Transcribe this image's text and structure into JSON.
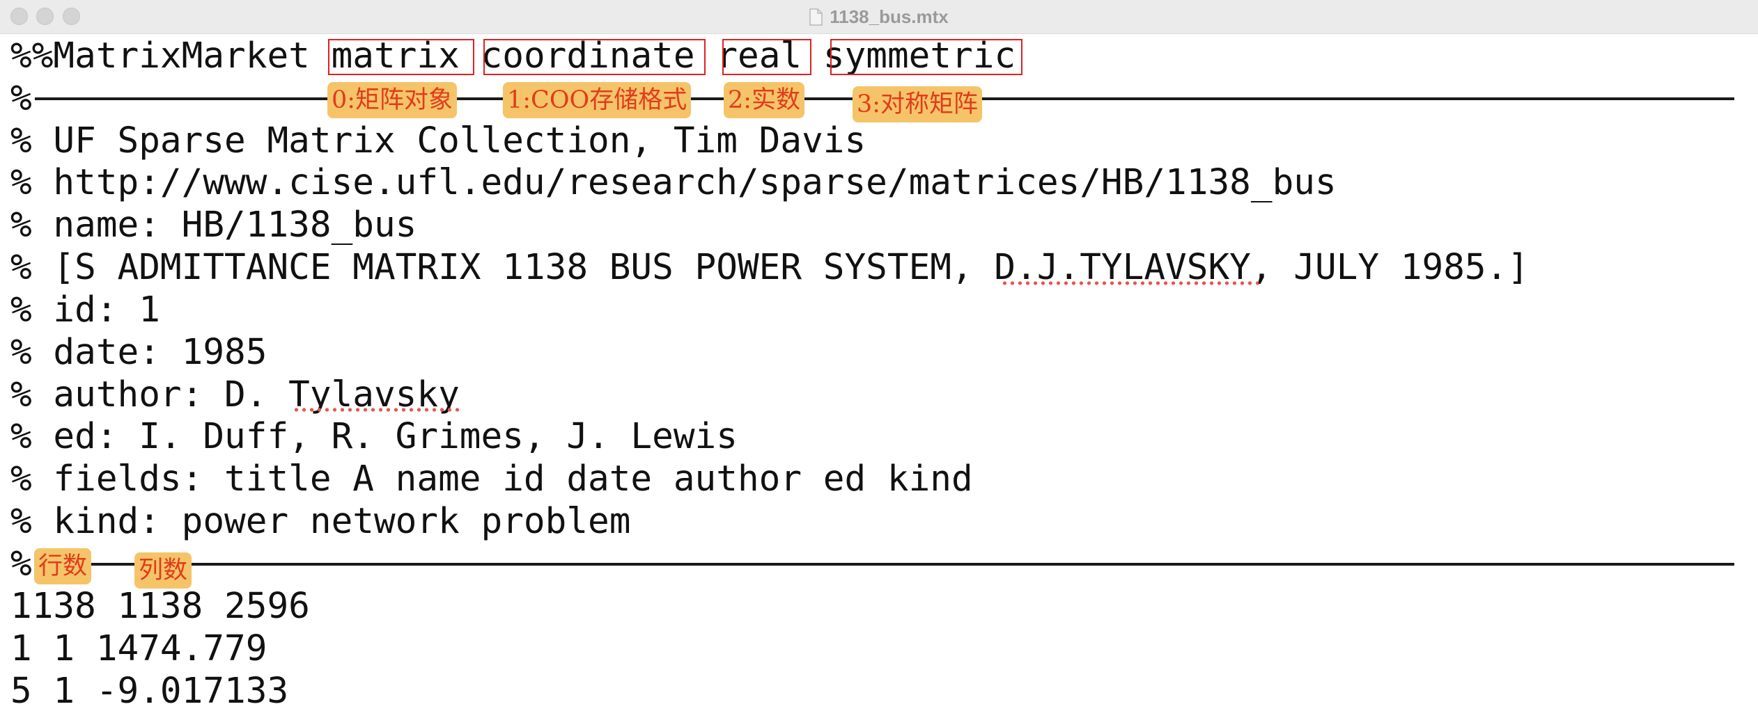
{
  "window": {
    "title": "1138_bus.mtx",
    "file_icon": "document-icon"
  },
  "header_line": {
    "prefix": "%%MatrixMarket",
    "tokens": [
      "matrix",
      "coordinate",
      "real",
      "symmetric"
    ]
  },
  "annotations": {
    "header_tags": [
      "0:矩阵对象",
      "1:COO存储格式",
      "2:实数",
      "3:对称矩阵"
    ],
    "size_tags": [
      "行数",
      "列数"
    ],
    "highlight_color": "#f5c469",
    "box_color": "#e02020"
  },
  "comment_lines": [
    "% UF Sparse Matrix Collection, Tim Davis",
    "% http://www.cise.ufl.edu/research/sparse/matrices/HB/1138_bus",
    "% name: HB/1138_bus",
    "% [S ADMITTANCE MATRIX 1138 BUS POWER SYSTEM, D.J.TYLAVSKY, JULY 1985.]",
    "% id: 1",
    "% date: 1985",
    "% author: D. Tylavsky",
    "% ed: I. Duff, R. Grimes, J. Lewis",
    "% fields: title A name id date author ed kind",
    "% kind: power network problem"
  ],
  "separator_prefix": "%",
  "data_lines": [
    "1138 1138 2596",
    "1 1 1474.779",
    "5 1 -9.017133"
  ]
}
